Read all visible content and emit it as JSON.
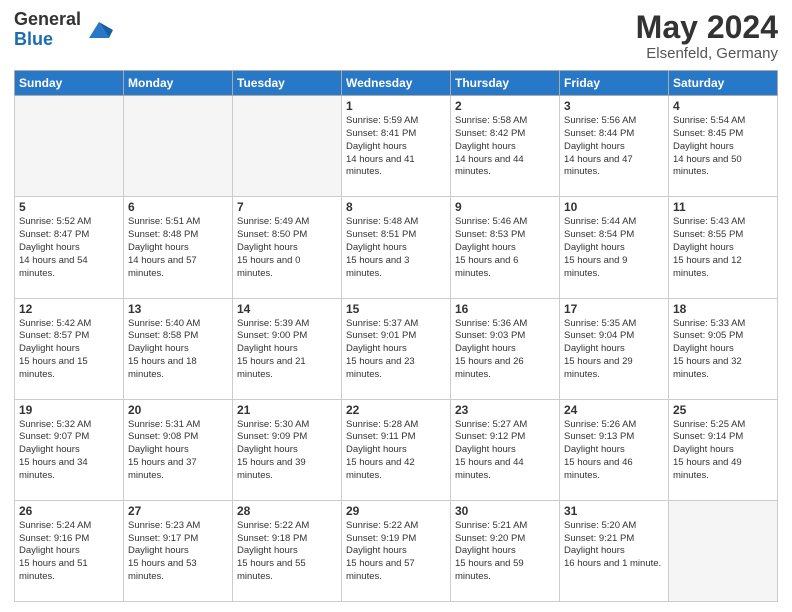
{
  "header": {
    "logo_general": "General",
    "logo_blue": "Blue",
    "month_title": "May 2024",
    "location": "Elsenfeld, Germany"
  },
  "calendar": {
    "days_of_week": [
      "Sunday",
      "Monday",
      "Tuesday",
      "Wednesday",
      "Thursday",
      "Friday",
      "Saturday"
    ],
    "weeks": [
      [
        {
          "day": "",
          "empty": true
        },
        {
          "day": "",
          "empty": true
        },
        {
          "day": "",
          "empty": true
        },
        {
          "day": "1",
          "sunrise": "5:59 AM",
          "sunset": "8:41 PM",
          "daylight": "14 hours and 41 minutes."
        },
        {
          "day": "2",
          "sunrise": "5:58 AM",
          "sunset": "8:42 PM",
          "daylight": "14 hours and 44 minutes."
        },
        {
          "day": "3",
          "sunrise": "5:56 AM",
          "sunset": "8:44 PM",
          "daylight": "14 hours and 47 minutes."
        },
        {
          "day": "4",
          "sunrise": "5:54 AM",
          "sunset": "8:45 PM",
          "daylight": "14 hours and 50 minutes."
        }
      ],
      [
        {
          "day": "5",
          "sunrise": "5:52 AM",
          "sunset": "8:47 PM",
          "daylight": "14 hours and 54 minutes."
        },
        {
          "day": "6",
          "sunrise": "5:51 AM",
          "sunset": "8:48 PM",
          "daylight": "14 hours and 57 minutes."
        },
        {
          "day": "7",
          "sunrise": "5:49 AM",
          "sunset": "8:50 PM",
          "daylight": "15 hours and 0 minutes."
        },
        {
          "day": "8",
          "sunrise": "5:48 AM",
          "sunset": "8:51 PM",
          "daylight": "15 hours and 3 minutes."
        },
        {
          "day": "9",
          "sunrise": "5:46 AM",
          "sunset": "8:53 PM",
          "daylight": "15 hours and 6 minutes."
        },
        {
          "day": "10",
          "sunrise": "5:44 AM",
          "sunset": "8:54 PM",
          "daylight": "15 hours and 9 minutes."
        },
        {
          "day": "11",
          "sunrise": "5:43 AM",
          "sunset": "8:55 PM",
          "daylight": "15 hours and 12 minutes."
        }
      ],
      [
        {
          "day": "12",
          "sunrise": "5:42 AM",
          "sunset": "8:57 PM",
          "daylight": "15 hours and 15 minutes."
        },
        {
          "day": "13",
          "sunrise": "5:40 AM",
          "sunset": "8:58 PM",
          "daylight": "15 hours and 18 minutes."
        },
        {
          "day": "14",
          "sunrise": "5:39 AM",
          "sunset": "9:00 PM",
          "daylight": "15 hours and 21 minutes."
        },
        {
          "day": "15",
          "sunrise": "5:37 AM",
          "sunset": "9:01 PM",
          "daylight": "15 hours and 23 minutes."
        },
        {
          "day": "16",
          "sunrise": "5:36 AM",
          "sunset": "9:03 PM",
          "daylight": "15 hours and 26 minutes."
        },
        {
          "day": "17",
          "sunrise": "5:35 AM",
          "sunset": "9:04 PM",
          "daylight": "15 hours and 29 minutes."
        },
        {
          "day": "18",
          "sunrise": "5:33 AM",
          "sunset": "9:05 PM",
          "daylight": "15 hours and 32 minutes."
        }
      ],
      [
        {
          "day": "19",
          "sunrise": "5:32 AM",
          "sunset": "9:07 PM",
          "daylight": "15 hours and 34 minutes."
        },
        {
          "day": "20",
          "sunrise": "5:31 AM",
          "sunset": "9:08 PM",
          "daylight": "15 hours and 37 minutes."
        },
        {
          "day": "21",
          "sunrise": "5:30 AM",
          "sunset": "9:09 PM",
          "daylight": "15 hours and 39 minutes."
        },
        {
          "day": "22",
          "sunrise": "5:28 AM",
          "sunset": "9:11 PM",
          "daylight": "15 hours and 42 minutes."
        },
        {
          "day": "23",
          "sunrise": "5:27 AM",
          "sunset": "9:12 PM",
          "daylight": "15 hours and 44 minutes."
        },
        {
          "day": "24",
          "sunrise": "5:26 AM",
          "sunset": "9:13 PM",
          "daylight": "15 hours and 46 minutes."
        },
        {
          "day": "25",
          "sunrise": "5:25 AM",
          "sunset": "9:14 PM",
          "daylight": "15 hours and 49 minutes."
        }
      ],
      [
        {
          "day": "26",
          "sunrise": "5:24 AM",
          "sunset": "9:16 PM",
          "daylight": "15 hours and 51 minutes."
        },
        {
          "day": "27",
          "sunrise": "5:23 AM",
          "sunset": "9:17 PM",
          "daylight": "15 hours and 53 minutes."
        },
        {
          "day": "28",
          "sunrise": "5:22 AM",
          "sunset": "9:18 PM",
          "daylight": "15 hours and 55 minutes."
        },
        {
          "day": "29",
          "sunrise": "5:22 AM",
          "sunset": "9:19 PM",
          "daylight": "15 hours and 57 minutes."
        },
        {
          "day": "30",
          "sunrise": "5:21 AM",
          "sunset": "9:20 PM",
          "daylight": "15 hours and 59 minutes."
        },
        {
          "day": "31",
          "sunrise": "5:20 AM",
          "sunset": "9:21 PM",
          "daylight": "16 hours and 1 minute."
        },
        {
          "day": "",
          "empty": true
        }
      ]
    ]
  }
}
